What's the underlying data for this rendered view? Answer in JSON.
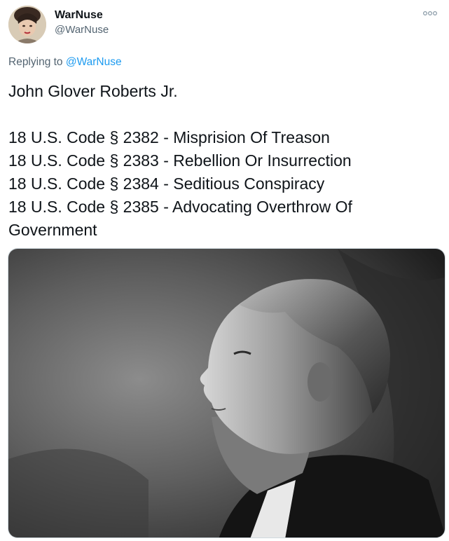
{
  "tweet": {
    "author": {
      "display_name": "WarNuse",
      "handle": "@WarNuse",
      "avatar_icon": "profile-avatar"
    },
    "more_icon": "more-options-icon",
    "replying": {
      "prefix": "Replying to",
      "mention": "@WarNuse"
    },
    "text_lines": [
      "John Glover Roberts Jr.",
      "",
      "18 U.S. Code § 2382 - Misprision Of Treason",
      "18 U.S. Code § 2383 - Rebellion Or Insurrection",
      "18 U.S. Code § 2384 - Seditious Conspiracy",
      "18 U.S. Code § 2385 - Advocating Overthrow Of",
      "Government"
    ],
    "media": {
      "kind": "photo",
      "style": "black-and-white"
    }
  },
  "colors": {
    "text_primary": "#0f1419",
    "text_secondary": "#536471",
    "link": "#1d9bf0",
    "border": "#cfd9de"
  }
}
